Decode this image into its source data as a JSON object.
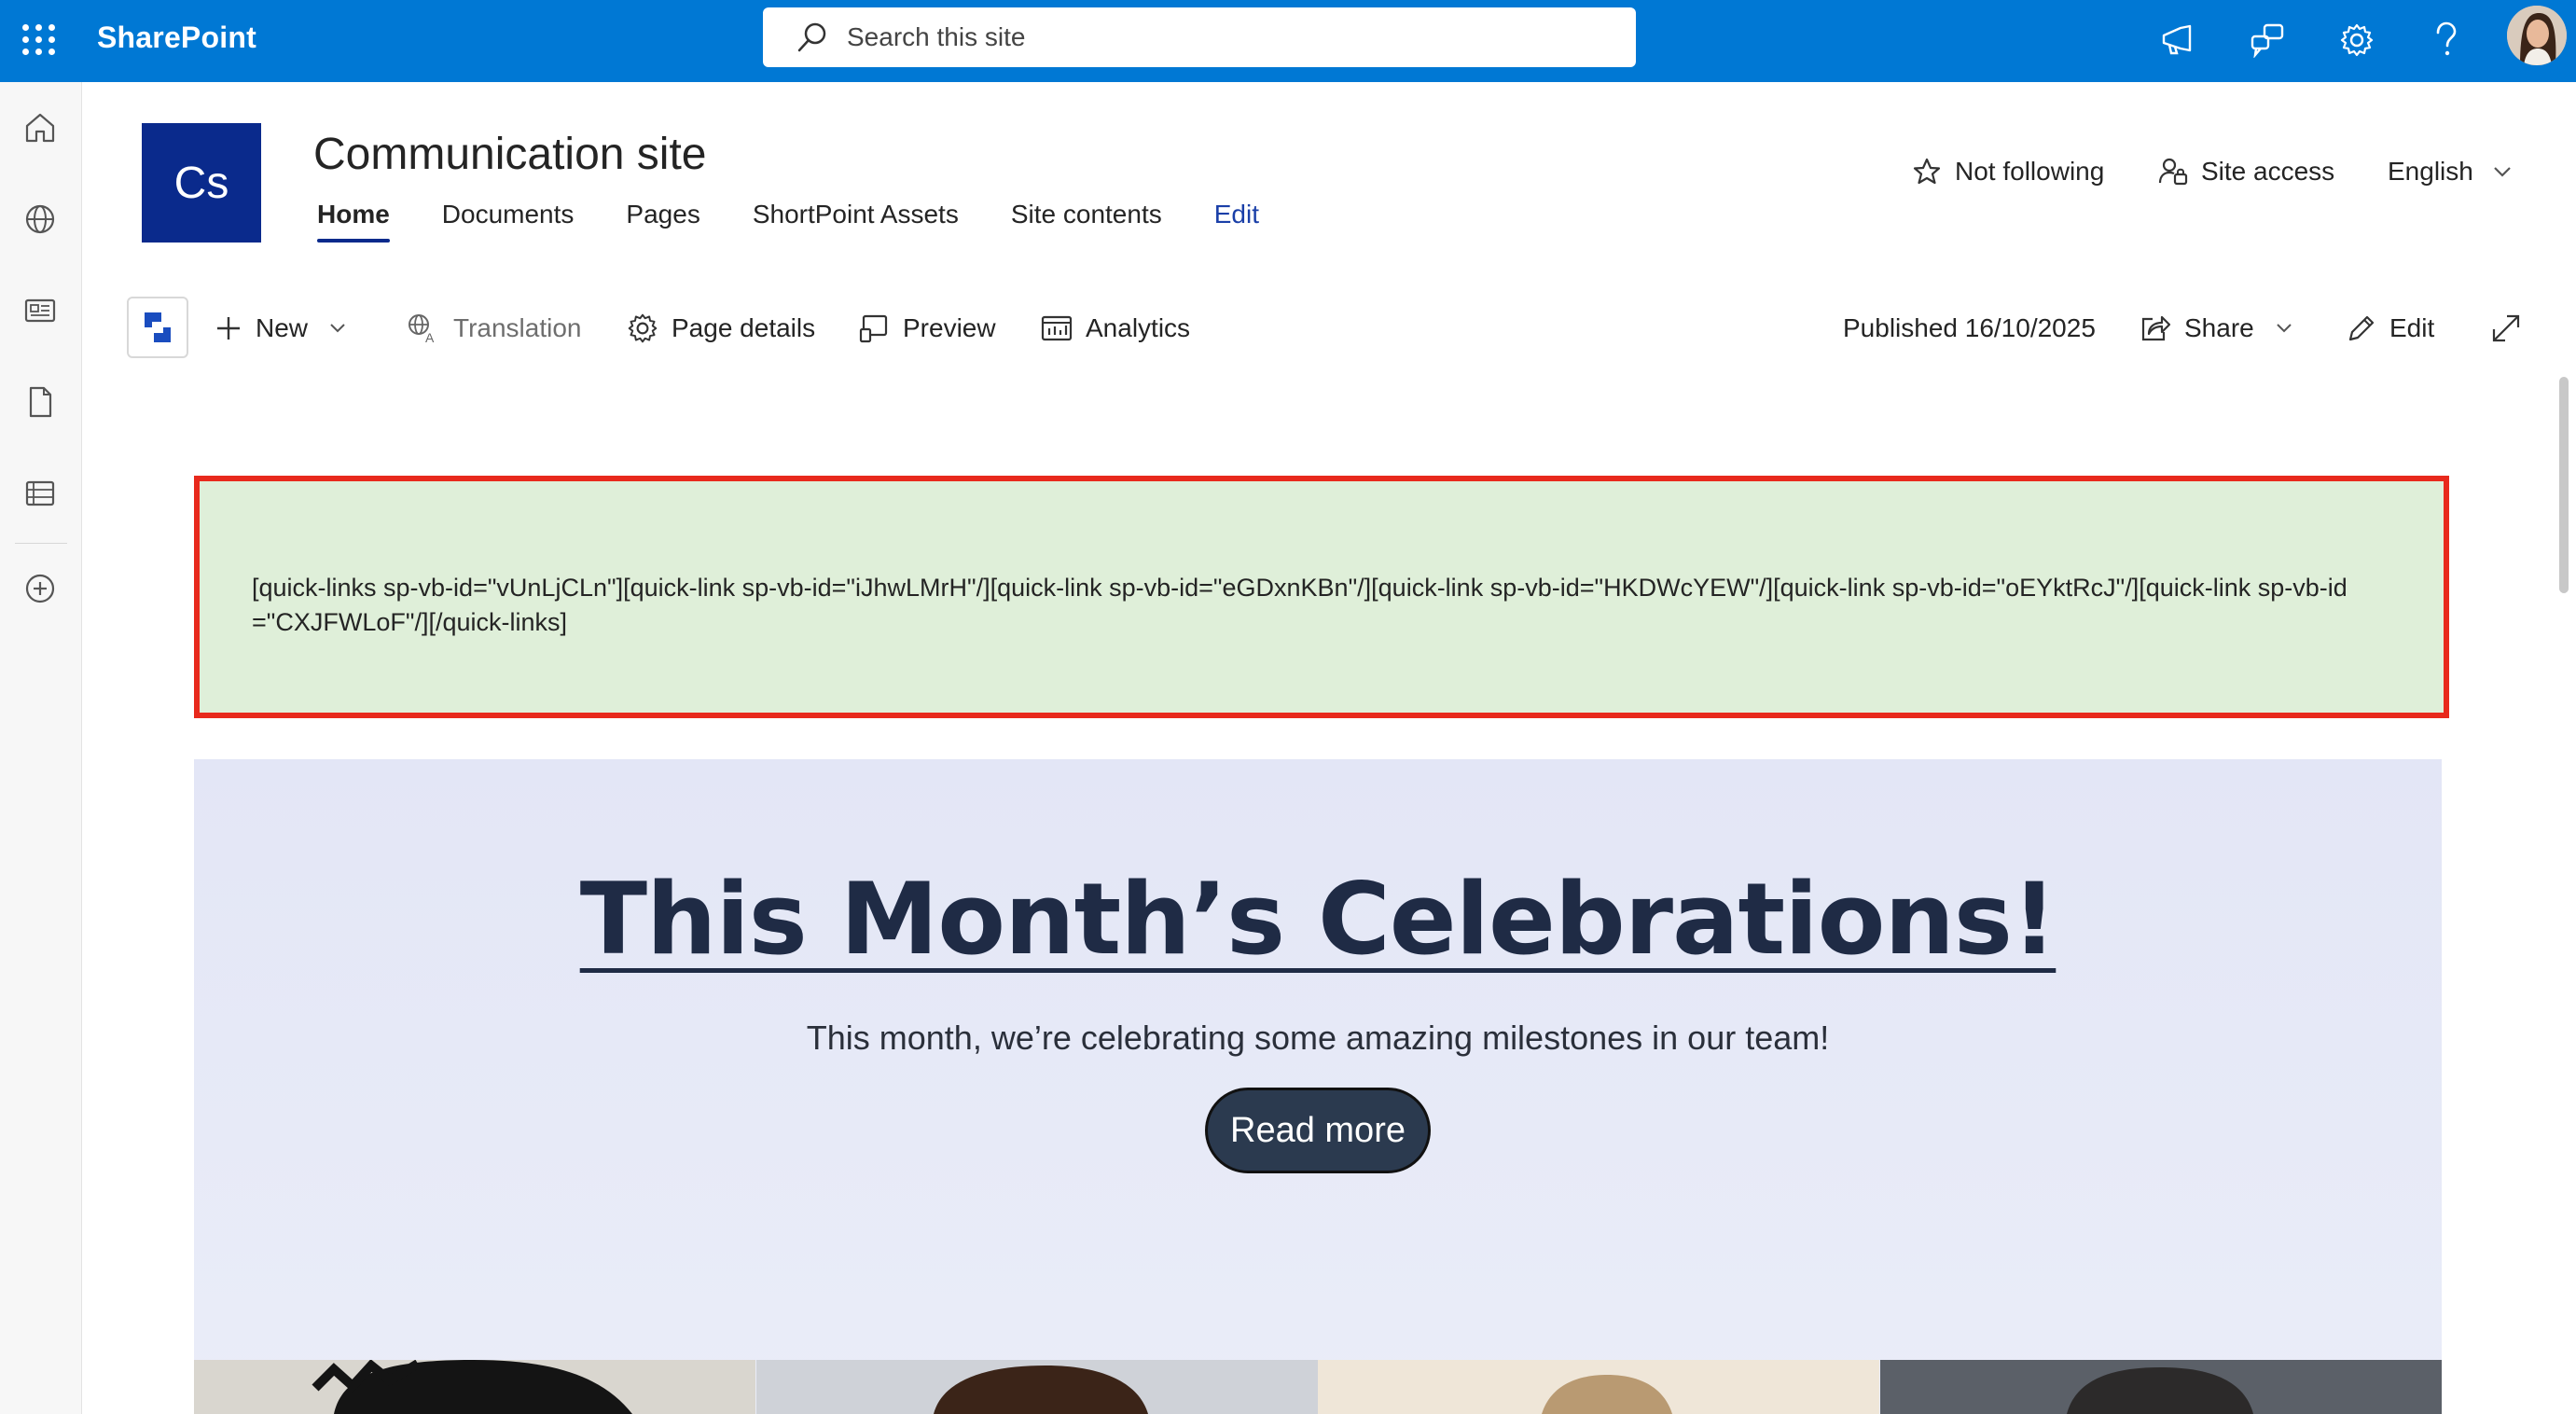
{
  "suitebar": {
    "brand": "SharePoint",
    "search_placeholder": "Search this site"
  },
  "site": {
    "logo_initials": "Cs",
    "title": "Communication site",
    "nav": [
      {
        "label": "Home",
        "active": true
      },
      {
        "label": "Documents"
      },
      {
        "label": "Pages"
      },
      {
        "label": "ShortPoint Assets"
      },
      {
        "label": "Site contents"
      },
      {
        "label": "Edit"
      }
    ],
    "actions": {
      "follow": "Not following",
      "site_access": "Site access",
      "language": "English"
    }
  },
  "commandbar": {
    "new": "New",
    "translation": "Translation",
    "page_details": "Page details",
    "preview": "Preview",
    "analytics": "Analytics",
    "published": "Published 16/10/2025",
    "share": "Share",
    "edit": "Edit"
  },
  "shortcode": {
    "text": "[quick-links sp-vb-id=\"vUnLjCLn\"][quick-link sp-vb-id=\"iJhwLMrH\"/][quick-link sp-vb-id=\"eGDxnKBn\"/][quick-link sp-vb-id=\"HKDWcYEW\"/][quick-link sp-vb-id=\"oEYktRcJ\"/][quick-link sp-vb-id=\"CXJFWLoF\"/][/quick-links]"
  },
  "hero": {
    "title": "This Month’s Celebrations!",
    "subtitle": "This month, we’re celebrating some amazing milestones in our team!",
    "button": "Read more"
  },
  "colors": {
    "suitebar": "#0078d4",
    "logo_bg": "#0a2a8c",
    "shortcode_bg": "#dfefd9",
    "shortcode_border": "#e8291c",
    "hero_title": "#1f2b45",
    "hero_button": "#2b3a4f"
  }
}
